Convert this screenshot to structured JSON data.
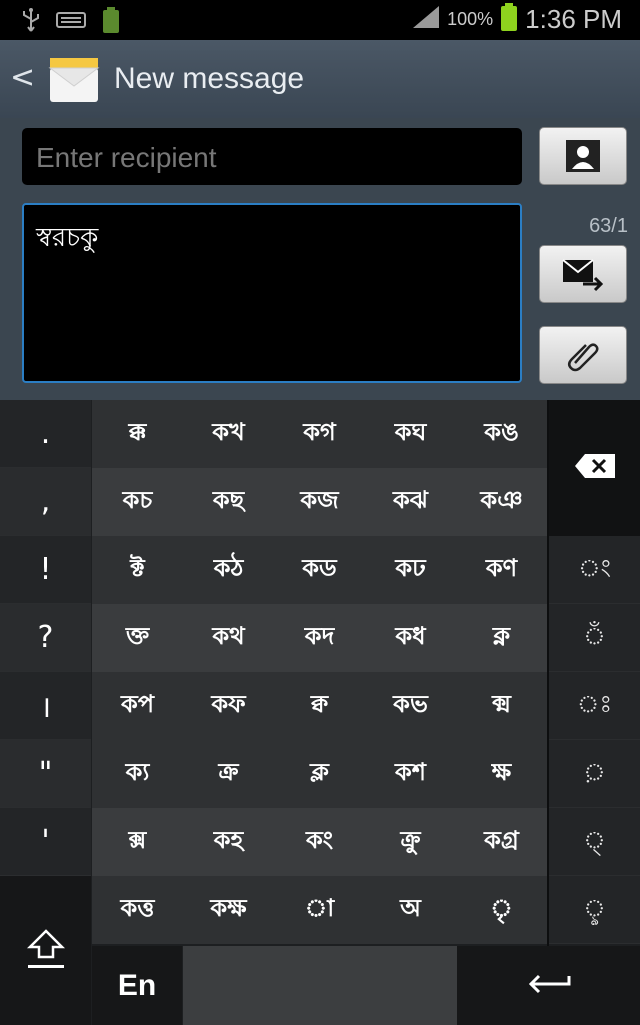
{
  "status_bar": {
    "battery_percent": "100%",
    "time": "1:36 PM"
  },
  "header": {
    "back_icon": "chevron-left-icon",
    "app_icon": "envelope-icon",
    "title": "New message"
  },
  "compose": {
    "recipient_placeholder": "Enter recipient",
    "message_text": "স্বরচকু",
    "char_counter": "63/1",
    "contact_icon": "contact-icon",
    "send_icon": "send-mms-icon",
    "attach_icon": "paperclip-icon"
  },
  "keyboard": {
    "punctuation": [
      ".",
      ",",
      "!",
      "?",
      "।",
      "\"",
      "'"
    ],
    "conjunct_rows": [
      [
        "ক্ক",
        "কখ",
        "কগ",
        "কঘ",
        "কঙ"
      ],
      [
        "কচ",
        "কছ",
        "কজ",
        "কঝ",
        "কঞ"
      ],
      [
        "ক্ট",
        "কঠ",
        "কড",
        "কঢ",
        "কণ"
      ],
      [
        "ক্ত",
        "কথ",
        "কদ",
        "কধ",
        "ক্ন"
      ],
      [
        "কপ",
        "কফ",
        "ক্ব",
        "কভ",
        "ক্ম"
      ],
      [
        "ক্য",
        "ক্র",
        "ক্ল",
        "কশ",
        "ক্ষ"
      ],
      [
        "ক্স",
        "কহ",
        "কং",
        "ক্রু",
        "কগ্র"
      ],
      [
        "কত্ত",
        "কক্ষ",
        "◌া",
        "অ",
        "◌ৃ"
      ]
    ],
    "vowel_signs": [
      "◌ং",
      "◌ঁ",
      "◌ঃ",
      "◌়",
      "◌্",
      "◌ৢ"
    ],
    "lang_label": "En",
    "shift_icon": "shift-icon",
    "backspace_icon": "backspace-icon",
    "enter_icon": "enter-icon"
  }
}
